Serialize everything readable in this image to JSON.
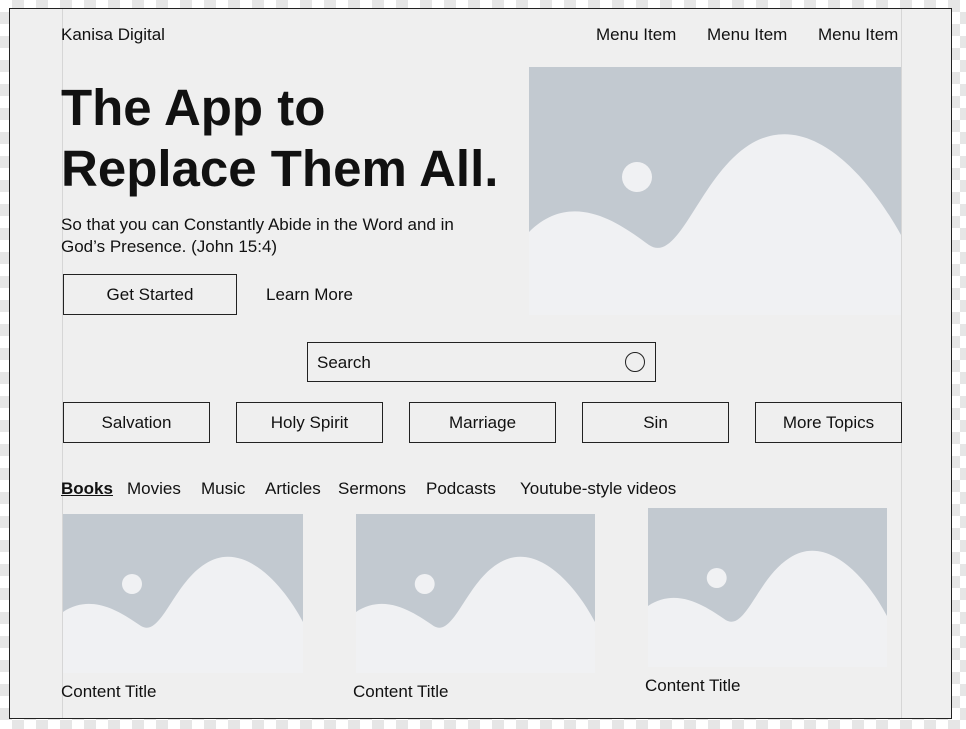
{
  "header": {
    "brand": "Kanisa Digital",
    "menu": [
      "Menu Item",
      "Menu Item",
      "Menu Item"
    ]
  },
  "hero": {
    "title_line1": "The App to",
    "title_line2": "Replace Them All.",
    "subtitle_line1": "So that you can Constantly Abide in the Word and in",
    "subtitle_line2": "God’s Presence. (John 15:4)",
    "primary_button": "Get Started",
    "secondary_link": "Learn More"
  },
  "search": {
    "label": "Search"
  },
  "topics": [
    "Salvation",
    "Holy Spirit",
    "Marriage",
    "Sin",
    "More Topics"
  ],
  "tabs": [
    "Books",
    "Movies",
    "Music",
    "Articles",
    "Sermons",
    "Podcasts",
    "Youtube-style videos"
  ],
  "active_tab": "Books",
  "cards": [
    {
      "title": "Content Title"
    },
    {
      "title": "Content Title"
    },
    {
      "title": "Content Title"
    }
  ],
  "colors": {
    "placeholder_sky": "#c2c9d0",
    "placeholder_land": "#f0f1f3",
    "frame_background": "#efefef"
  }
}
